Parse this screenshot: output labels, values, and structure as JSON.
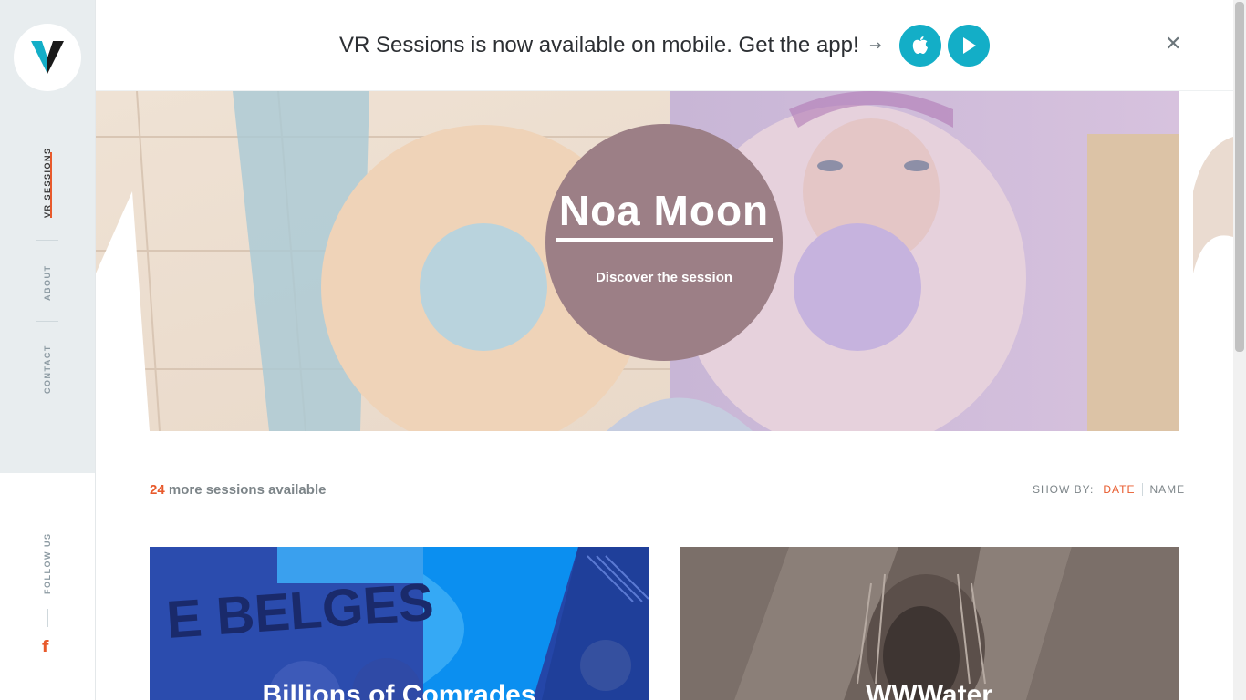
{
  "sidebar": {
    "logo_alt": "VR Sessions",
    "nav": [
      {
        "label": "VR SESSIONS",
        "active": true
      },
      {
        "label": "ABOUT",
        "active": false
      },
      {
        "label": "CONTACT",
        "active": false
      }
    ],
    "follow_label": "FOLLOW US",
    "facebook_glyph": "f"
  },
  "banner": {
    "text": "VR Sessions is now available on mobile. Get the app!",
    "arrow": "→",
    "apple_icon": "apple-icon",
    "play_icon": "play-store-icon",
    "close_glyph": "✕"
  },
  "hero": {
    "title": "Noa Moon",
    "cta": "Discover the session"
  },
  "sessions": {
    "count": "24",
    "count_suffix": " more sessions available",
    "show_by_label": "SHOW BY:",
    "sort_date": "DATE",
    "sort_name": "NAME"
  },
  "cards": [
    {
      "title": "Billions of Comrades"
    },
    {
      "title": "WWWater"
    }
  ],
  "colors": {
    "accent": "#e85a2c",
    "store_button": "#13aec7",
    "hero_circle": "#9c7f86"
  }
}
